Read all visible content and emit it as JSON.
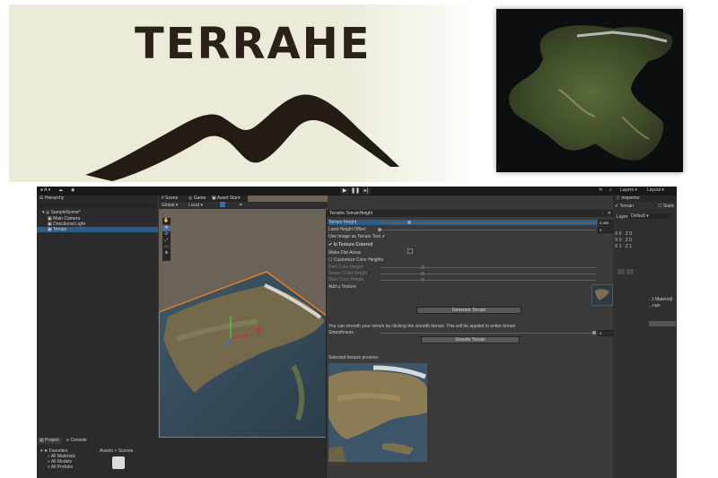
{
  "banner": {
    "logo_text": "TERRAHE"
  },
  "toolbar": {
    "account": "A",
    "layers_label": "Layers",
    "layout_label": "Layout"
  },
  "hierarchy": {
    "tab": "Hierarchy",
    "items": [
      "SampleScene*",
      "Main Camera",
      "Directional Light",
      "Terrain"
    ]
  },
  "scene": {
    "tabs": [
      "Scene",
      "Game",
      "Asset Store"
    ],
    "shading": "Global",
    "pivot": "Local"
  },
  "window": {
    "title": "Terrahe.TerrainHeight",
    "terrain_height_label": "Terrain Height",
    "terrain_height_value": "0.385",
    "land_height_offset_label": "Land Height Offset",
    "land_height_offset_value": "0",
    "use_image_label": "Use Image as Terrain Text",
    "is_texture_colored_label": "Is Texture Colored",
    "make_flat_areas_label": "Make Flat Areas",
    "customize_color_label": "Customize Color Heights",
    "red_color_label": "Red Color Height",
    "green_color_label": "Green Color Height",
    "blue_color_label": "Blue Color Height",
    "add_texture_label": "Add a Texture",
    "generate_button": "Generate Terrain",
    "smooth_info": "You can smooth your terrain by clicking the smooth terrain. This will be applied to entire terrain",
    "smoothness_label": "Smoothness",
    "smoothness_value": "5",
    "smooth_button": "Smooth Terrain",
    "preview_label": "Selected texture preview:"
  },
  "inspector": {
    "tab": "Inspector",
    "object_name": "Terrain",
    "static_label": "Static",
    "layer_label": "Layer",
    "layer_value": "Default",
    "position_rows": [
      [
        "X",
        "0",
        "Z",
        "0"
      ],
      [
        "X",
        "0",
        "Z",
        "0"
      ],
      [
        "X",
        "1",
        "Z",
        "1"
      ]
    ],
    "material_label": "...t Material)",
    "terrain_label": "...rain"
  },
  "project": {
    "tabs": [
      "Project",
      "Console"
    ],
    "favorites_label": "Favorites",
    "favorites": [
      "All Materials",
      "All Models",
      "All Prefabs"
    ],
    "breadcrumb": "Assets > Scenes"
  }
}
